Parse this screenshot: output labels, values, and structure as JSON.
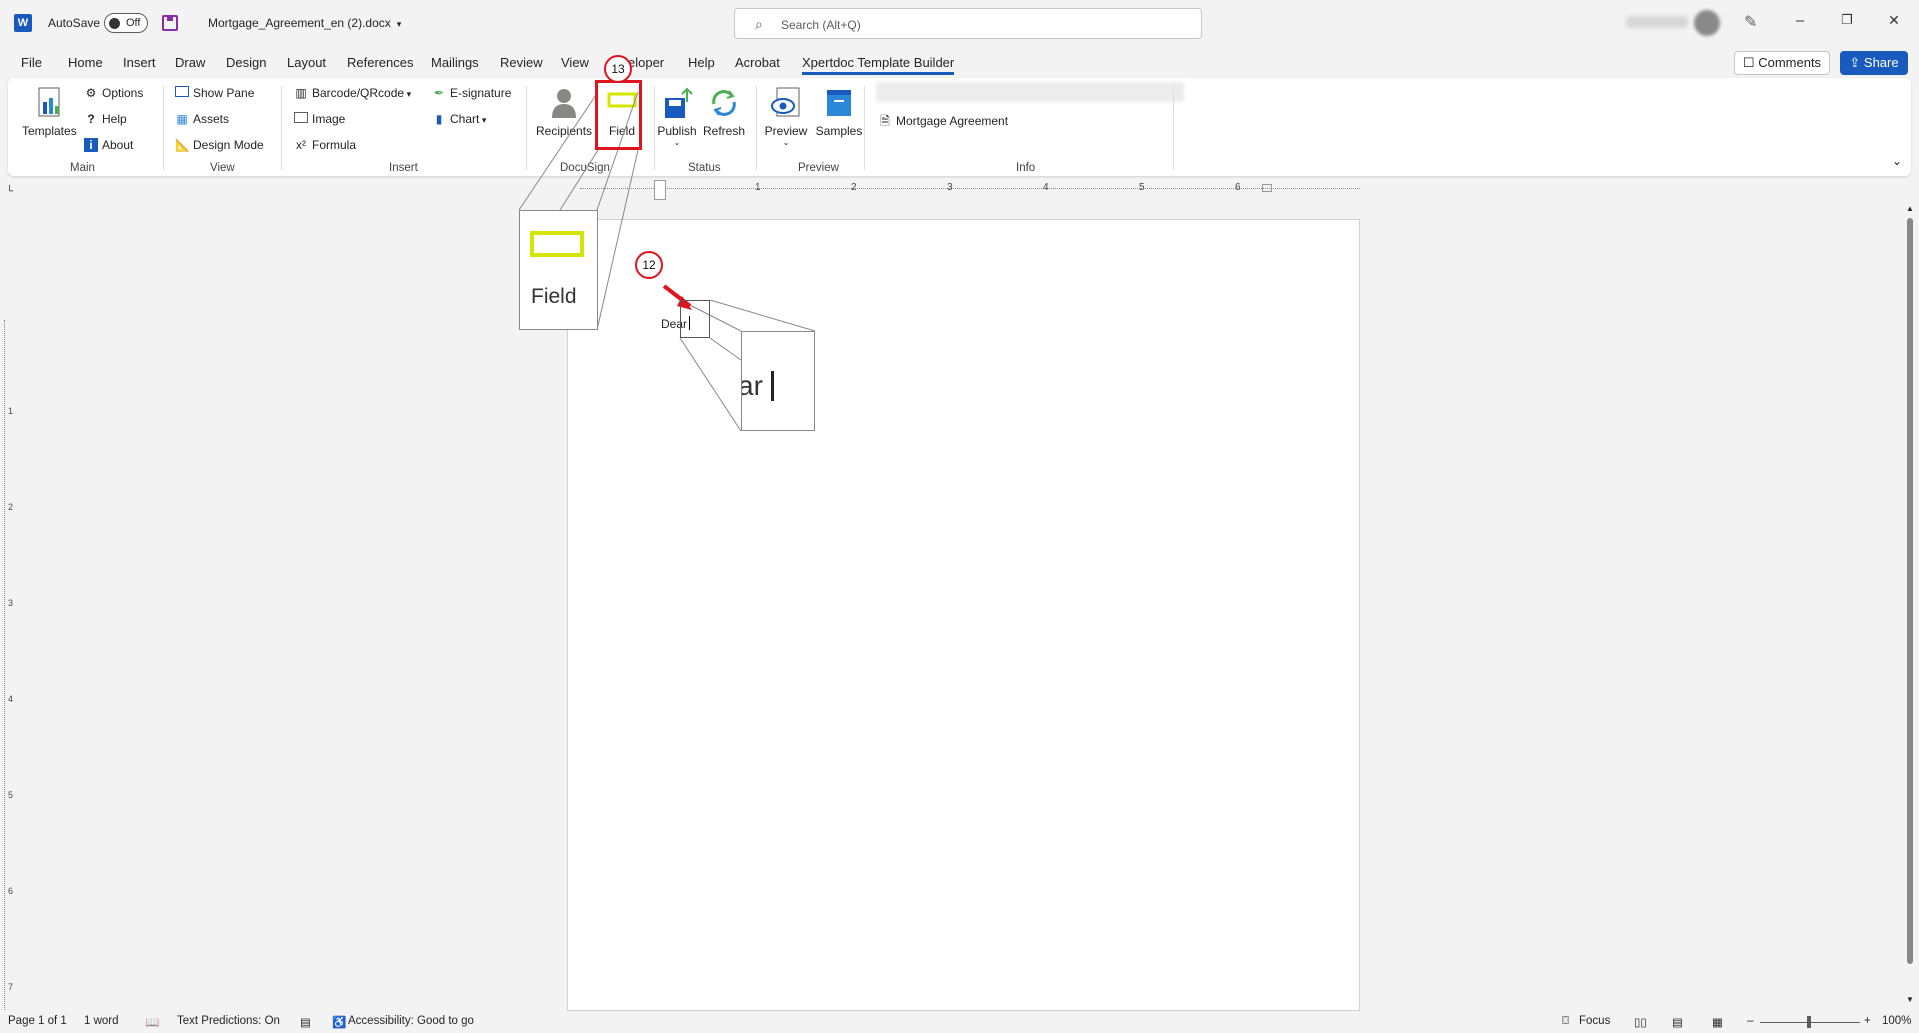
{
  "titlebar": {
    "app_icon": "W",
    "autosave_label": "AutoSave",
    "autosave_state": "Off",
    "filename": "Mortgage_Agreement_en (2).docx",
    "search_placeholder": "Search (Alt+Q)",
    "window_controls": [
      "–",
      "❐",
      "✕"
    ]
  },
  "menu": {
    "tabs": [
      "File",
      "Home",
      "Insert",
      "Draw",
      "Design",
      "Layout",
      "References",
      "Mailings",
      "Review",
      "View",
      "Developer",
      "Help",
      "Acrobat",
      "Xpertdoc Template Builder"
    ],
    "developer_visible": "eloper",
    "active_tab": "Xpertdoc Template Builder",
    "comments_label": "Comments",
    "share_label": "Share"
  },
  "ribbon": {
    "main": {
      "label": "Main",
      "templates": "Templates",
      "options": "Options",
      "help": "Help",
      "about": "About"
    },
    "view": {
      "label": "View",
      "show_pane": "Show Pane",
      "assets": "Assets",
      "design_mode": "Design Mode"
    },
    "insert": {
      "label": "Insert",
      "barcode": "Barcode/QRcode",
      "image": "Image",
      "formula": "Formula",
      "esignature": "E-signature",
      "chart": "Chart"
    },
    "docusign": {
      "label": "DocuSign",
      "recipients": "Recipients",
      "field": "Field"
    },
    "status": {
      "label": "Status",
      "publish": "Publish",
      "refresh": "Refresh"
    },
    "preview": {
      "label": "Preview",
      "preview": "Preview",
      "samples": "Samples"
    },
    "info": {
      "label": "Info",
      "template_name": "Mortgage Agreement"
    }
  },
  "ruler": {
    "h_numbers": [
      "1",
      "2",
      "3",
      "4",
      "5",
      "6"
    ],
    "v_numbers": [
      "1",
      "2",
      "3",
      "4",
      "5",
      "6",
      "7"
    ]
  },
  "document": {
    "text": "Dear"
  },
  "callouts": {
    "step_field": "13",
    "step_cursor": "12",
    "zoom_field_label": "Field",
    "zoom_text": "ar"
  },
  "statusbar": {
    "page": "Page 1 of 1",
    "words": "1 word",
    "text_predictions": "Text Predictions: On",
    "accessibility": "Accessibility: Good to go",
    "focus": "Focus",
    "zoom": "100%"
  },
  "colors": {
    "accent": "#185abd",
    "highlight": "#e0141e",
    "field_icon": "#d4e600"
  }
}
